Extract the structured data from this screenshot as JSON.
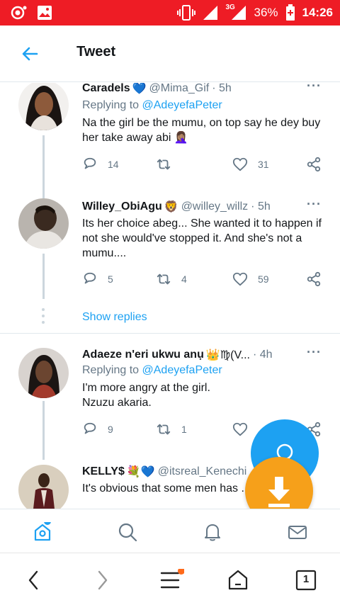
{
  "status_bar": {
    "network": "3G",
    "battery": "36%",
    "time": "14:26"
  },
  "header": {
    "title": "Tweet"
  },
  "tweets": [
    {
      "name": "Caradels",
      "name_emoji": "💙",
      "handle": "@Mima_Gif",
      "time": "· 5h",
      "reply_prefix": "Replying to",
      "reply_to": "@AdeyefaPeter",
      "text": "Na the girl be the mumu, on top say he dey buy her take away abi",
      "text_emoji": "🤦🏽‍♀️",
      "replies": "14",
      "retweets": "",
      "likes": "31"
    },
    {
      "name": "Willey_ObiAgu",
      "name_emoji": "🦁",
      "handle": "@willey_willz",
      "time": "· 5h",
      "text": "Its her choice abeg... She wanted it to happen if not she would've stopped it. And she's not a mumu....",
      "replies": "5",
      "retweets": "4",
      "likes": "59",
      "show_replies": "Show replies"
    },
    {
      "name": "Adaeze n'eri ukwu anụ",
      "name_emoji": "👑♍(V...",
      "handle": "",
      "time": "· 4h",
      "reply_prefix": "Replying to",
      "reply_to": "@AdeyefaPeter",
      "text_line1": "I'm more angry at the girl.",
      "text_line2": "Nzuzu akaria.",
      "replies": "9",
      "retweets": "1",
      "likes": ""
    },
    {
      "name": "KELLY$",
      "name_emoji": "💐💙",
      "handle": "@itsreal_Kenechi",
      "text": "It's obvious that some men has ... for our women... this is madnes..."
    }
  ],
  "colors": {
    "status_bar": "#ee1c25",
    "accent": "#1da1f2",
    "download_fab": "#f6a01a",
    "notification_dot": "#ff6a1a"
  },
  "tabs": [
    "home-icon",
    "search-icon",
    "notifications-icon",
    "messages-icon"
  ],
  "browser_nav": {
    "tab_count": "1"
  }
}
